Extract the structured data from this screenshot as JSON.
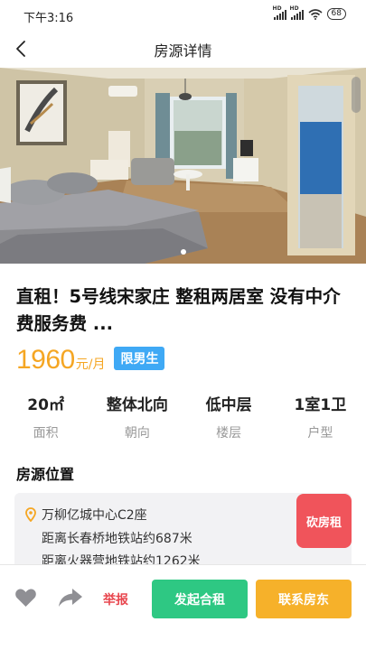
{
  "status_bar": {
    "time": "下午3:16",
    "battery": "68"
  },
  "nav": {
    "title": "房源详情"
  },
  "gallery": {
    "total_images": 1,
    "current_index": 1
  },
  "listing": {
    "title": "直租！5号线宋家庄 整租两居室 没有中介费服务费 ...",
    "price": "1960",
    "price_unit": "元/月",
    "badge": "限男生"
  },
  "stats": [
    {
      "value": "20㎡",
      "label": "面积"
    },
    {
      "value": "整体北向",
      "label": "朝向"
    },
    {
      "value": "低中层",
      "label": "楼层"
    },
    {
      "value": "1室1卫",
      "label": "户型"
    }
  ],
  "location": {
    "section_title": "房源位置",
    "address": "万柳亿城中心C2座",
    "subway_lines": [
      "距离长春桥地铁站约687米",
      "距离火器营地铁站约1262米"
    ],
    "bargain_label": "砍房租"
  },
  "actions": {
    "report": "举报",
    "share_rent": "发起合租",
    "contact": "联系房东"
  },
  "colors": {
    "price": "#f5a623",
    "badge": "#3fa9f5",
    "bargain": "#f0545b",
    "share_rent": "#2ec883",
    "contact": "#f6b12a",
    "report": "#e8474f"
  },
  "icons": [
    "back-icon",
    "heart-icon",
    "share-arrow-icon",
    "location-pin-icon"
  ]
}
